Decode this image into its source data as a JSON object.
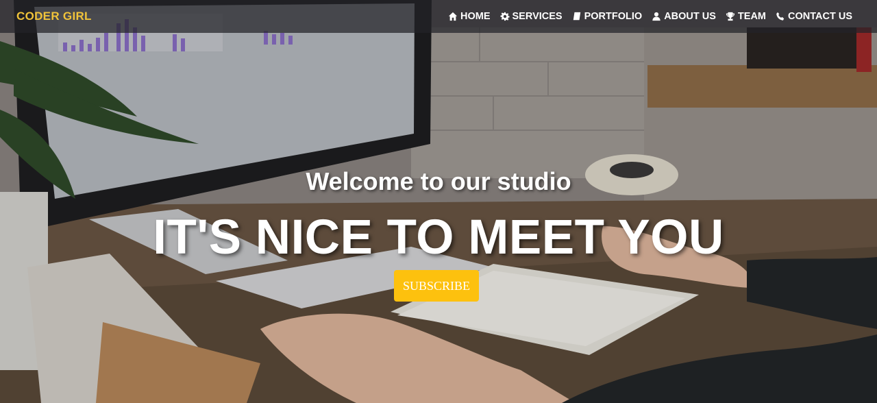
{
  "brand": {
    "name": "CODER GIRL",
    "color": "#f0c33a"
  },
  "nav": {
    "items": [
      {
        "label": "HOME",
        "icon": "home-icon"
      },
      {
        "label": "SERVICES",
        "icon": "gear-icon"
      },
      {
        "label": "PORTFOLIO",
        "icon": "book-icon"
      },
      {
        "label": "ABOUT US",
        "icon": "user-icon"
      },
      {
        "label": "TEAM",
        "icon": "trophy-icon"
      },
      {
        "label": "CONTACT US",
        "icon": "phone-icon"
      }
    ]
  },
  "hero": {
    "subheading": "Welcome to our studio",
    "heading": "IT'S NICE TO MEET YOU",
    "button_label": "SUBSCRIBE",
    "button_color": "#fdc10e",
    "background": "desk workspace photo with monitor, keyboard, notebook and hands"
  }
}
